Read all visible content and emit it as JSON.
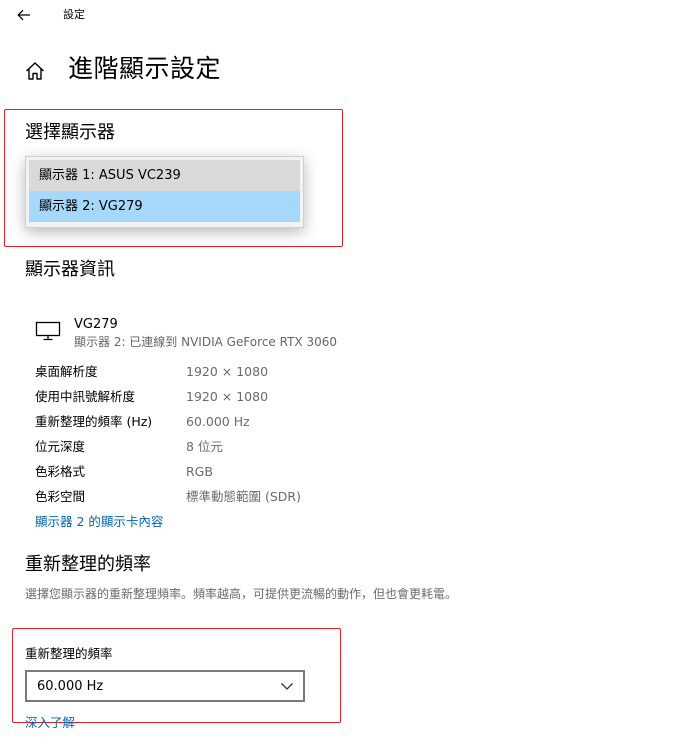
{
  "topbar": {
    "back_icon": "back-arrow-icon",
    "title": "設定"
  },
  "page": {
    "home_icon": "home-icon",
    "title": "進階顯示設定"
  },
  "select_display": {
    "heading": "選擇顯示器",
    "options": [
      {
        "label": "顯示器 1: ASUS VC239",
        "state": "hover"
      },
      {
        "label": "顯示器 2: VG279",
        "state": "selected"
      }
    ]
  },
  "display_info": {
    "heading": "顯示器資訊",
    "monitor_icon": "monitor-icon",
    "monitor_name": "VG279",
    "monitor_desc": "顯示器 2: 已連線到 NVIDIA GeForce RTX 3060",
    "rows": [
      {
        "label": "桌面解析度",
        "value": "1920 × 1080"
      },
      {
        "label": "使用中訊號解析度",
        "value": "1920 × 1080"
      },
      {
        "label": "重新整理的頻率 (Hz)",
        "value": "60.000 Hz"
      },
      {
        "label": "位元深度",
        "value": "8 位元"
      },
      {
        "label": "色彩格式",
        "value": "RGB"
      },
      {
        "label": "色彩空間",
        "value": "標準動態範圍 (SDR)"
      }
    ],
    "adapter_link": "顯示器 2 的顯示卡內容"
  },
  "refresh_rate": {
    "heading": "重新整理的頻率",
    "description": "選擇您顯示器的重新整理頻率。頻率越高，可提供更流暢的動作，但也會更耗電。",
    "field_label": "重新整理的頻率",
    "selected_value": "60.000 Hz",
    "chevron_icon": "chevron-down-icon",
    "learn_more": "深入了解"
  },
  "colors": {
    "accent_link": "#0067b8",
    "selected_item": "#a6d8fb",
    "annotation_red": "#e0202a",
    "secondary_text": "#6b6b6b"
  }
}
